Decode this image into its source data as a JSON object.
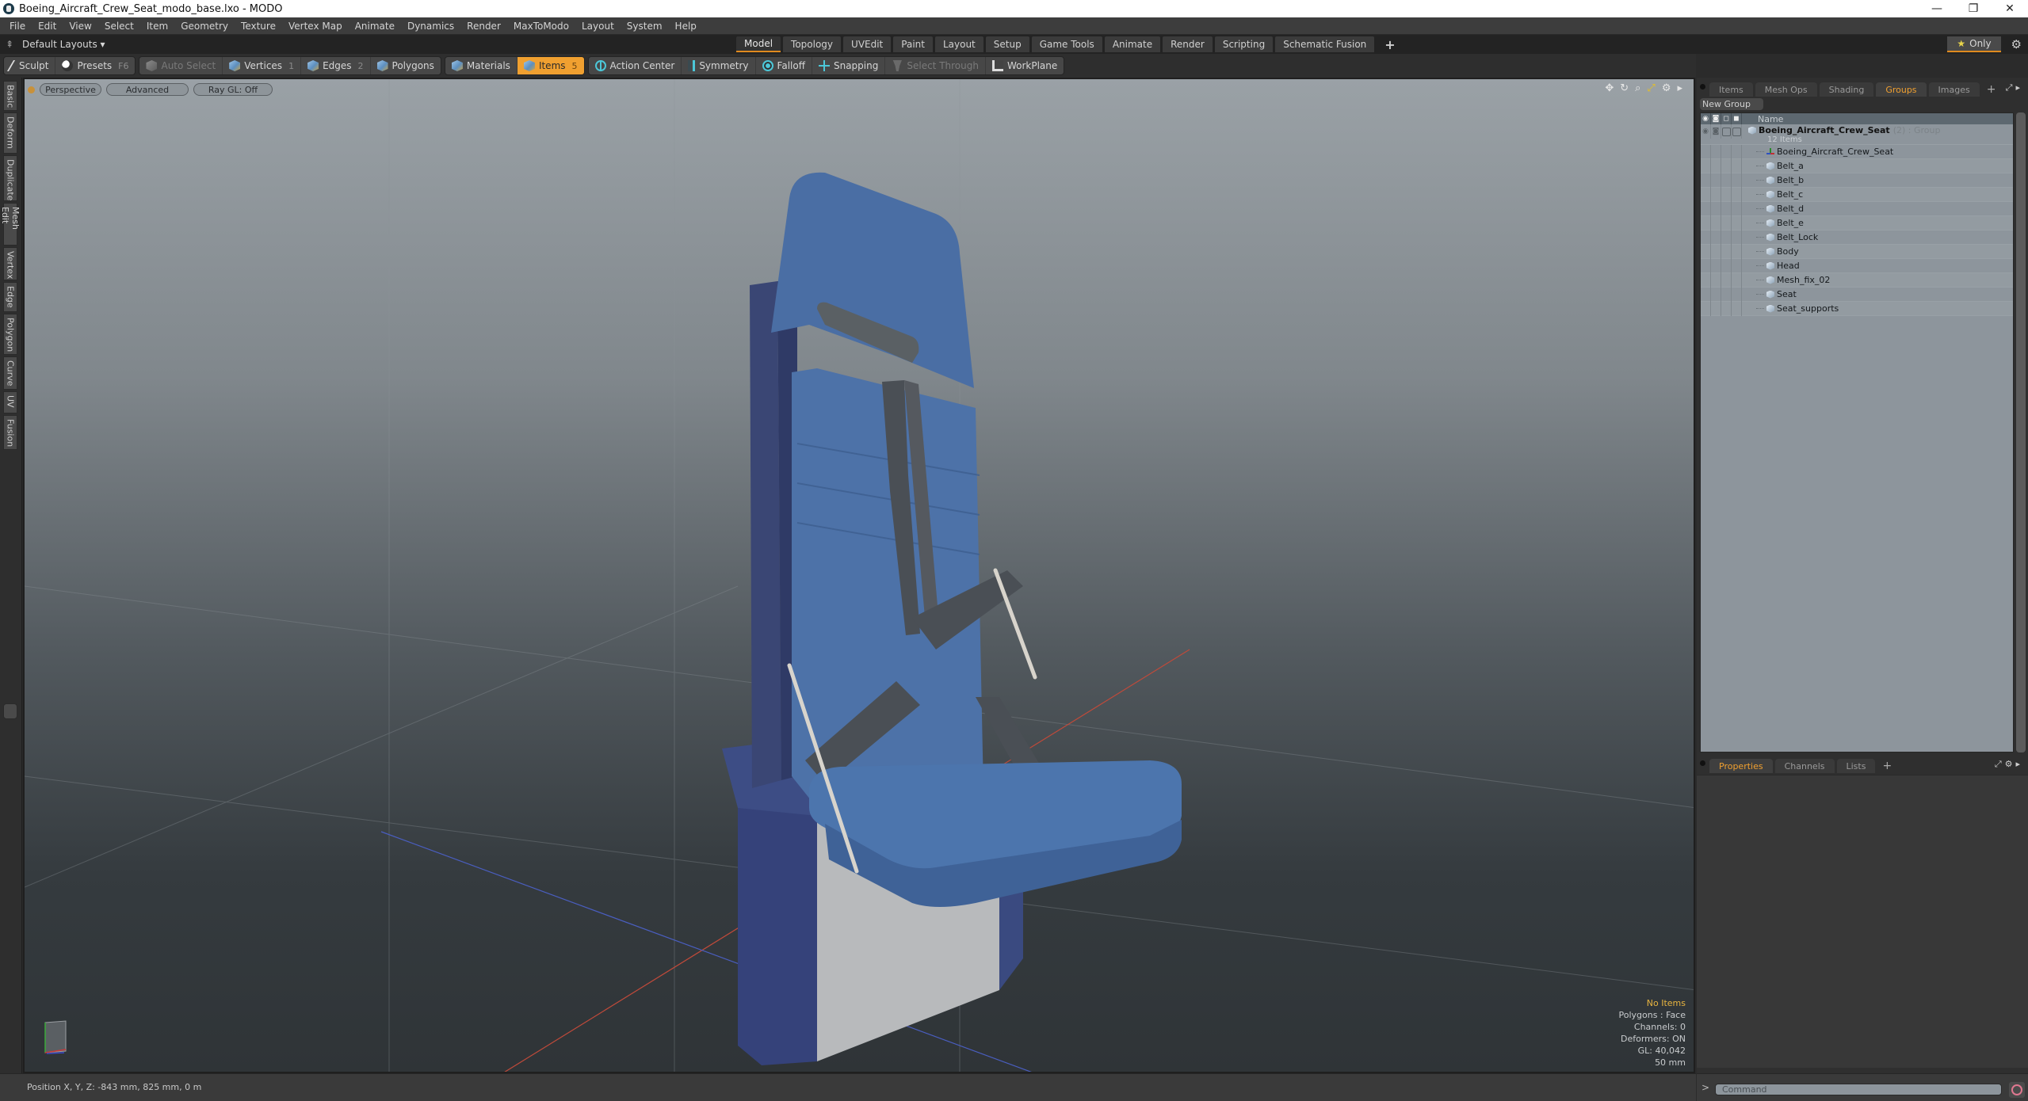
{
  "window": {
    "title": "Boeing_Aircraft_Crew_Seat_modo_base.lxo - MODO",
    "controls": {
      "minimize": "—",
      "restore": "❐",
      "close": "✕"
    }
  },
  "menubar": [
    "File",
    "Edit",
    "View",
    "Select",
    "Item",
    "Geometry",
    "Texture",
    "Vertex Map",
    "Animate",
    "Dynamics",
    "Render",
    "MaxToModo",
    "Layout",
    "System",
    "Help"
  ],
  "layoutbar": {
    "layouts_label": "Default Layouts ▾",
    "mode_tabs": [
      {
        "label": "Model",
        "active": true
      },
      {
        "label": "Topology"
      },
      {
        "label": "UVEdit"
      },
      {
        "label": "Paint"
      },
      {
        "label": "Layout"
      },
      {
        "label": "Setup"
      },
      {
        "label": "Game Tools"
      },
      {
        "label": "Animate"
      },
      {
        "label": "Render"
      },
      {
        "label": "Scripting"
      },
      {
        "label": "Schematic Fusion"
      }
    ],
    "add_tab": "+",
    "only_label": "Only",
    "only_icon": "star-icon",
    "gear_icon": "gear-icon"
  },
  "toolbar": {
    "sculpt": "Sculpt",
    "presets": "Presets",
    "presets_key": "F6",
    "auto_select": "Auto Select",
    "vertices": "Vertices",
    "vertices_key": "1",
    "edges": "Edges",
    "edges_key": "2",
    "polygons": "Polygons",
    "materials": "Materials",
    "items": "Items",
    "items_key": "5",
    "action_center": "Action Center",
    "symmetry": "Symmetry",
    "falloff": "Falloff",
    "snapping": "Snapping",
    "select_through": "Select Through",
    "workplane": "WorkPlane"
  },
  "left_tabs": [
    "Basic",
    "Deform",
    "Duplicate",
    "Mesh Edit",
    "Vertex",
    "Edge",
    "Polygon",
    "Curve",
    "UV",
    "Fusion"
  ],
  "viewport": {
    "view_mode": "Perspective",
    "shading": "Advanced",
    "raygl": "Ray GL: Off",
    "info": {
      "selection": "No Items",
      "polygons": "Polygons : Face",
      "channels": "Channels: 0",
      "deformers": "Deformers: ON",
      "gl": "GL: 40,042",
      "grid": "50 mm"
    },
    "colors": {
      "seat_blue": "#4a72a8",
      "frame_navy": "#3a4a7a",
      "belt_grey": "#4a4f55",
      "metal": "#c8c8c8"
    }
  },
  "right_panel": {
    "top_tabs": [
      {
        "label": "Items"
      },
      {
        "label": "Mesh Ops"
      },
      {
        "label": "Shading"
      },
      {
        "label": "Groups",
        "active": true
      },
      {
        "label": "Images"
      }
    ],
    "new_group": "New Group",
    "tree_header": {
      "name": "Name"
    },
    "group": {
      "name": "Boeing_Aircraft_Crew_Seat",
      "meta": "(2) : Group",
      "count": "12 Items"
    },
    "items": [
      {
        "name": "Boeing_Aircraft_Crew_Seat",
        "type": "locator"
      },
      {
        "name": "Belt_a",
        "type": "mesh"
      },
      {
        "name": "Belt_b",
        "type": "mesh"
      },
      {
        "name": "Belt_c",
        "type": "mesh"
      },
      {
        "name": "Belt_d",
        "type": "mesh"
      },
      {
        "name": "Belt_e",
        "type": "mesh"
      },
      {
        "name": "Belt_Lock",
        "type": "mesh"
      },
      {
        "name": "Body",
        "type": "mesh"
      },
      {
        "name": "Head",
        "type": "mesh"
      },
      {
        "name": "Mesh_fix_02",
        "type": "mesh"
      },
      {
        "name": "Seat",
        "type": "mesh"
      },
      {
        "name": "Seat_supports",
        "type": "mesh"
      }
    ],
    "bottom_tabs": [
      {
        "label": "Properties",
        "active": true
      },
      {
        "label": "Channels"
      },
      {
        "label": "Lists"
      }
    ]
  },
  "statusbar": {
    "position": "Position X, Y, Z:   -843 mm, 825 mm, 0 m"
  },
  "command": {
    "prompt": ">",
    "placeholder": "Command"
  }
}
